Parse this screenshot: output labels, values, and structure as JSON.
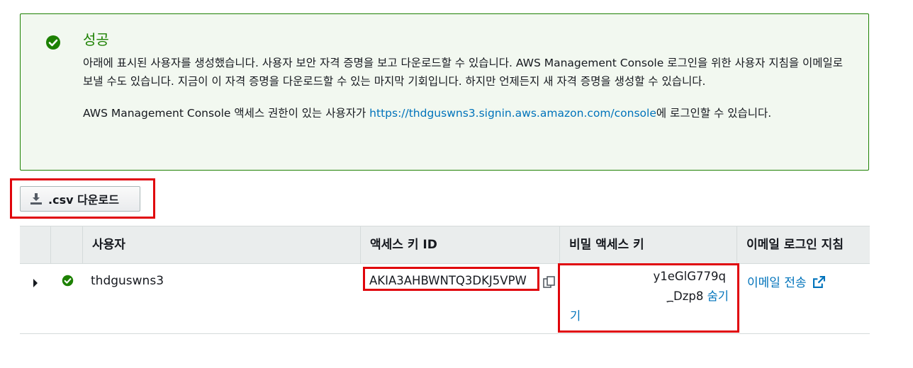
{
  "alert": {
    "title": "성공",
    "line1": "아래에 표시된 사용자를 생성했습니다. 사용자 보안 자격 증명을 보고 다운로드할 수 있습니다. AWS Management Console 로그인을 위한 사용자 지침을 이메일로 보낼 수도 있습니다. 지금이 이 자격 증명을 다운로드할 수 있는 마지막 기회입니다. 하지만 언제든지 새 자격 증명을 생성할 수 있습니다.",
    "line2_prefix": "AWS Management Console 액세스 권한이 있는 사용자가 ",
    "console_url": "https://thdguswns3.signin.aws.amazon.com/console",
    "line2_suffix": "에 로그인할 수 있습니다."
  },
  "download_button": {
    "label": ".csv 다운로드"
  },
  "table": {
    "columns": [
      "사용자",
      "액세스 키 ID",
      "비밀 액세스 키",
      "이메일 로그인 지침"
    ],
    "rows": [
      {
        "user": "thdguswns3",
        "access_key_id": "AKIA3AHBWNTQ3DKJ5VPW",
        "secret_part1": "y1eGlG779q",
        "secret_part2": "؁Dzp8",
        "hide_label_a": "숨기",
        "hide_label_b": "기",
        "email_send_label": "이메일 전송"
      }
    ]
  },
  "colors": {
    "success": "#1d8102",
    "link": "#0073bb",
    "highlight": "#e0040b"
  }
}
